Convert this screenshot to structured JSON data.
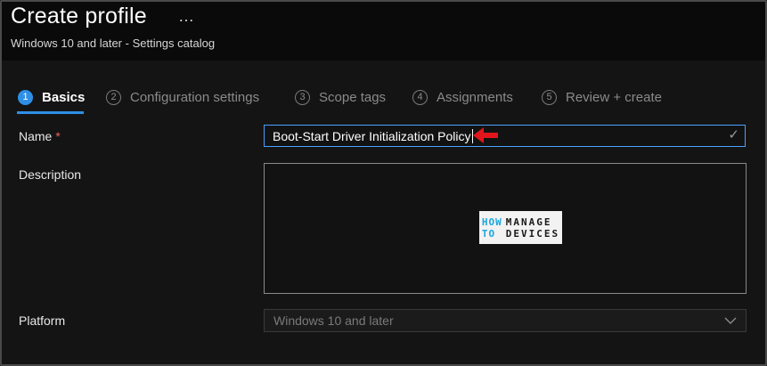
{
  "header": {
    "title": "Create profile",
    "more_icon": "…",
    "subtitle": "Windows 10 and later - Settings catalog"
  },
  "tabs": [
    {
      "num": "1",
      "label": "Basics",
      "active": true
    },
    {
      "num": "2",
      "label": "Configuration settings",
      "active": false
    },
    {
      "num": "3",
      "label": "Scope tags",
      "active": false
    },
    {
      "num": "4",
      "label": "Assignments",
      "active": false
    },
    {
      "num": "5",
      "label": "Review + create",
      "active": false
    }
  ],
  "form": {
    "name_label": "Name",
    "required_mark": "*",
    "name_value": "Boot-Start Driver Initialization Policy",
    "description_label": "Description",
    "description_value": "",
    "platform_label": "Platform",
    "platform_value": "Windows 10 and later"
  },
  "watermark": {
    "left_top": "HOW",
    "left_bottom": "TO",
    "right_top": "MANAGE",
    "right_bottom": "DEVICES"
  },
  "colors": {
    "accent": "#2f8fe6",
    "annotation_arrow": "#e0161c",
    "required": "#f06060"
  },
  "icons": [
    "more-icon",
    "check-icon",
    "arrow-icon",
    "chevron-down-icon"
  ]
}
